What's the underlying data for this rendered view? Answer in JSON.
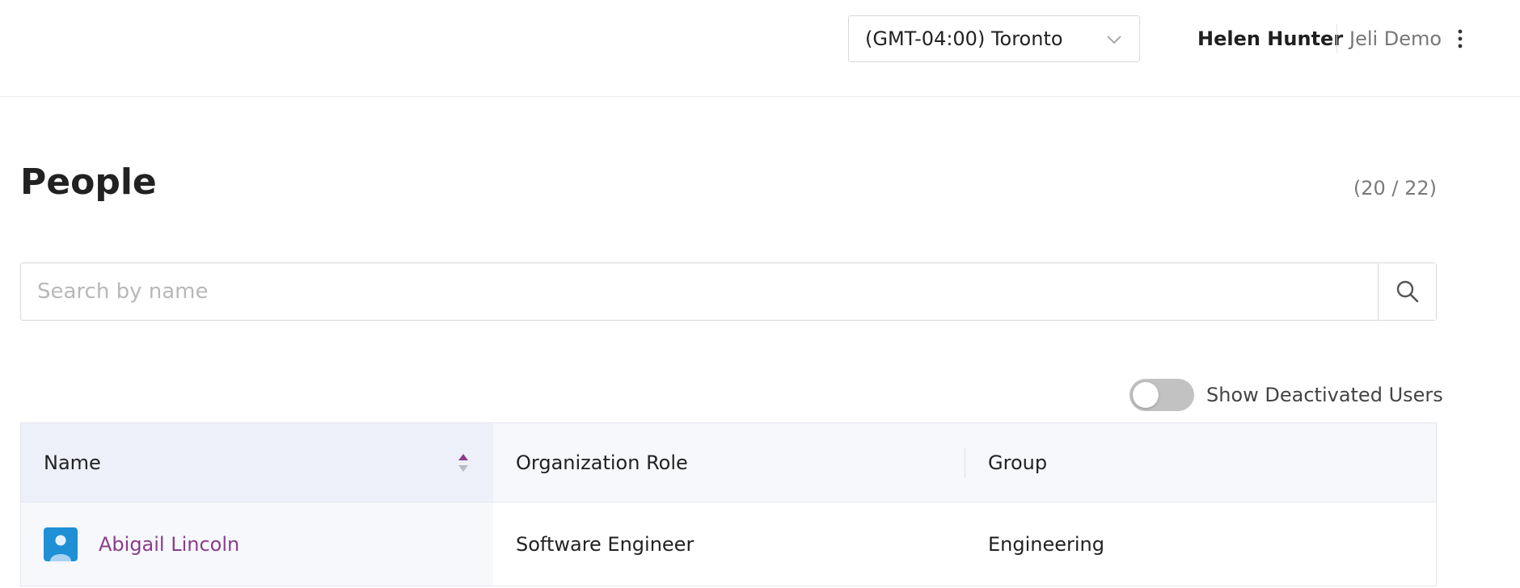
{
  "header": {
    "timezone": "(GMT-04:00) Toronto",
    "user_name": "Helen Hunter",
    "org_name": "Jeli Demo"
  },
  "page": {
    "title": "People",
    "count": "(20 / 22)"
  },
  "search": {
    "placeholder": "Search by name"
  },
  "filters": {
    "show_deactivated_label": "Show Deactivated Users",
    "show_deactivated": false
  },
  "table": {
    "columns": [
      "Name",
      "Organization Role",
      "Group"
    ],
    "rows": [
      {
        "name": "Abigail Lincoln",
        "role": "Software Engineer",
        "group": "Engineering"
      }
    ]
  },
  "colors": {
    "accent": "#8a3d8c",
    "avatar": "#1f8fd6",
    "toggle_off": "#c2c2c2"
  }
}
